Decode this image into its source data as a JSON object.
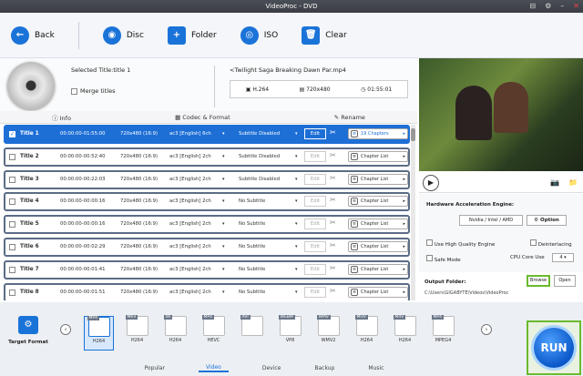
{
  "window": {
    "title": "VideoProc - DVD"
  },
  "toolbar": {
    "back": "Back",
    "disc": "Disc",
    "folder": "Folder",
    "iso": "ISO",
    "clear": "Clear"
  },
  "info": {
    "selected_title": "Selected Title:title 1",
    "merge": "Merge titles",
    "filename": "<Twilight Saga Breaking Dawn Par.mp4",
    "codec": "H.264",
    "resolution": "720x480",
    "duration": "01:55:01"
  },
  "tabs": {
    "info": "Info",
    "codec": "Codec & Format",
    "rename": "Rename"
  },
  "rows": [
    {
      "title": "Title 1",
      "time": "00:00:00-01:55:00",
      "res": "720x480 (16:9)",
      "audio": "ac3 [English] 6ch",
      "sub": "Subtitle Disabled",
      "edit": "Edit",
      "chap": "19 Chapters",
      "selected": true
    },
    {
      "title": "Title 2",
      "time": "00:00:00-00:52:40",
      "res": "720x480 (16:9)",
      "audio": "ac3 [English] 2ch",
      "sub": "Subtitle Disabled",
      "edit": "Edit",
      "chap": "Chapter List",
      "selected": false
    },
    {
      "title": "Title 3",
      "time": "00:00:00-00:22:03",
      "res": "720x480 (16:9)",
      "audio": "ac3 [English] 2ch",
      "sub": "Subtitle Disabled",
      "edit": "Edit",
      "chap": "Chapter List",
      "selected": false
    },
    {
      "title": "Title 4",
      "time": "00:00:00-00:00:16",
      "res": "720x480 (16:9)",
      "audio": "ac3 [English] 2ch",
      "sub": "No Subtitle",
      "edit": "Edit",
      "chap": "Chapter List",
      "selected": false
    },
    {
      "title": "Title 5",
      "time": "00:00:00-00:00:16",
      "res": "720x480 (16:9)",
      "audio": "ac3 [English] 2ch",
      "sub": "No Subtitle",
      "edit": "Edit",
      "chap": "Chapter List",
      "selected": false
    },
    {
      "title": "Title 6",
      "time": "00:00:00-00:02:29",
      "res": "720x480 (16:9)",
      "audio": "ac3 [English] 2ch",
      "sub": "No Subtitle",
      "edit": "Edit",
      "chap": "Chapter List",
      "selected": false
    },
    {
      "title": "Title 7",
      "time": "00:00:00-00:01:41",
      "res": "720x480 (16:9)",
      "audio": "ac3 [English] 2ch",
      "sub": "No Subtitle",
      "edit": "Edit",
      "chap": "Chapter List",
      "selected": false
    },
    {
      "title": "Title 8",
      "time": "00:00:00-00:01:51",
      "res": "720x480 (16:9)",
      "audio": "ac3 [English] 2ch",
      "sub": "No Subtitle",
      "edit": "Edit",
      "chap": "Chapter List",
      "selected": false
    }
  ],
  "hw": {
    "title": "Hardware Acceleration Engine:",
    "nvidia": "Nvidia / Intel / AMD",
    "option": "Option",
    "hq": "Use High Quality Engine",
    "deint": "Deinterlacing",
    "safe": "Safe Mode",
    "core_label": "CPU Core Use",
    "core_val": "4"
  },
  "output": {
    "title": "Output Folder:",
    "path": "C:\\Users\\GIGABYTE\\Videos\\VideoProc",
    "browse": "Browse",
    "open": "Open"
  },
  "target": {
    "label": "Target Format"
  },
  "formats": [
    {
      "tag": "MP4",
      "name": "H264",
      "selected": true
    },
    {
      "tag": "MKV",
      "name": "H264",
      "selected": false
    },
    {
      "tag": "4K",
      "name": "H264",
      "selected": false
    },
    {
      "tag": "MP4",
      "name": "HEVC",
      "selected": false
    },
    {
      "tag": "AVI",
      "name": "",
      "selected": false
    },
    {
      "tag": "WEBM",
      "name": "VP8",
      "selected": false
    },
    {
      "tag": "WMV",
      "name": "WMV2",
      "selected": false
    },
    {
      "tag": "MOV",
      "name": "H264",
      "selected": false
    },
    {
      "tag": "M4V",
      "name": "H264",
      "selected": false
    },
    {
      "tag": "MP4",
      "name": "MPEG4",
      "selected": false
    }
  ],
  "btabs": [
    "Popular",
    "Video",
    "Device",
    "Backup",
    "Music"
  ],
  "run": "RUN"
}
